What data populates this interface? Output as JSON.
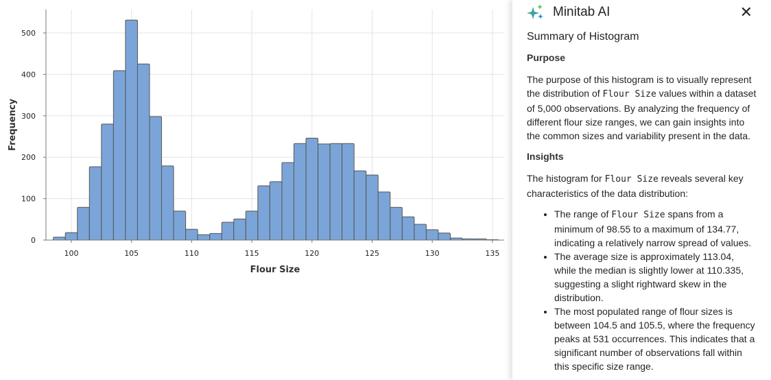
{
  "chart_data": {
    "type": "bar",
    "subtype": "histogram",
    "title": "",
    "xlabel": "Flour Size",
    "ylabel": "Frequency",
    "bin_width": 1,
    "bin_centers": [
      99,
      100,
      101,
      102,
      103,
      104,
      105,
      106,
      107,
      108,
      109,
      110,
      111,
      112,
      113,
      114,
      115,
      116,
      117,
      118,
      119,
      120,
      121,
      122,
      123,
      124,
      125,
      126,
      127,
      128,
      129,
      130,
      131,
      132,
      133,
      134,
      135
    ],
    "values": [
      7,
      18,
      79,
      177,
      280,
      409,
      531,
      425,
      298,
      179,
      70,
      26,
      13,
      16,
      43,
      51,
      70,
      131,
      141,
      187,
      233,
      246,
      232,
      233,
      233,
      167,
      157,
      116,
      79,
      56,
      38,
      25,
      17,
      5,
      3,
      3,
      1
    ],
    "xlim": [
      98,
      135.5
    ],
    "ylim": [
      0,
      560
    ],
    "xticks": [
      "100",
      "105",
      "110",
      "115",
      "120",
      "125",
      "130",
      "135"
    ],
    "yticks": [
      "0",
      "100",
      "200",
      "300",
      "400",
      "500"
    ],
    "grid": true,
    "bar_color": "#7BA5D8",
    "edge_color": "#555555"
  },
  "panel": {
    "title": "Minitab AI",
    "icon": "sparkle-icon",
    "close_icon": "close-icon",
    "heading": "Summary of Histogram",
    "purpose_heading": "Purpose",
    "purpose_pre": "The purpose of this histogram is to visually represent the distribution of ",
    "purpose_code": "Flour Size",
    "purpose_post": " values within a dataset of 5,000 observations. By analyzing the frequency of different flour size ranges, we can gain insights into the common sizes and variability present in the data.",
    "insights_heading": "Insights",
    "insights_pre": "The histogram for ",
    "insights_code": "Flour Size",
    "insights_post": " reveals several key characteristics of the data distribution:",
    "bullet1_pre": "The range of ",
    "bullet1_code": "Flour Size",
    "bullet1_post": " spans from a minimum of 98.55 to a maximum of 134.77, indicating a relatively narrow spread of values.",
    "bullet2": "The average size is approximately 113.04, while the median is slightly lower at 110.335, suggesting a slight rightward skew in the distribution.",
    "bullet3": "The most populated range of flour sizes is between 104.5 and 105.5, where the frequency peaks at 531 occurrences. This indicates that a significant number of observations fall within this specific size range."
  }
}
